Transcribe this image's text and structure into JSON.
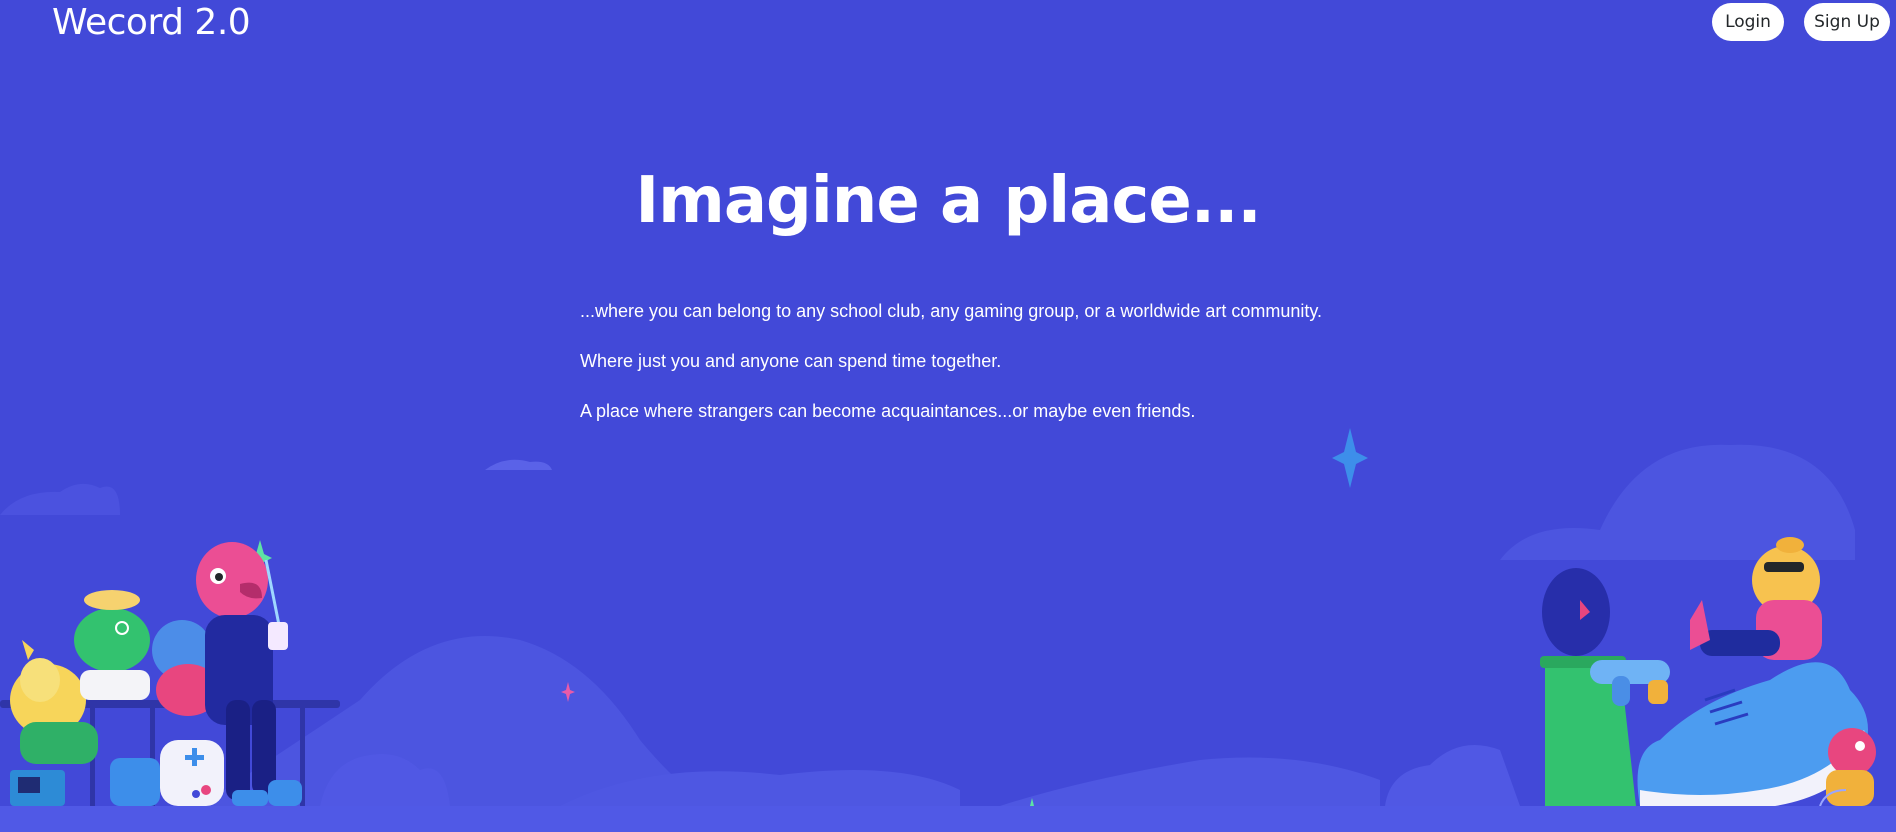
{
  "nav": {
    "brand": "Wecord 2.0",
    "login_label": "Login",
    "signup_label": "Sign Up"
  },
  "hero": {
    "title": "Imagine a place...",
    "lines": [
      "...where you can belong to any school club, any gaming group, or a worldwide art community.",
      "Where just you and anyone can spend time together.",
      "A place where strangers can become acquaintances...or maybe even friends."
    ]
  },
  "colors": {
    "background": "#4249d8",
    "hill": "#4e57e2",
    "button_bg": "#ffffff",
    "button_text": "#23272a"
  },
  "illustrations": {
    "left": "friends-hanging-out-illustration",
    "right": "friends-on-giant-sneaker-illustration",
    "sparkle": "sparkle-icon",
    "clouds": "cloud-icon"
  }
}
